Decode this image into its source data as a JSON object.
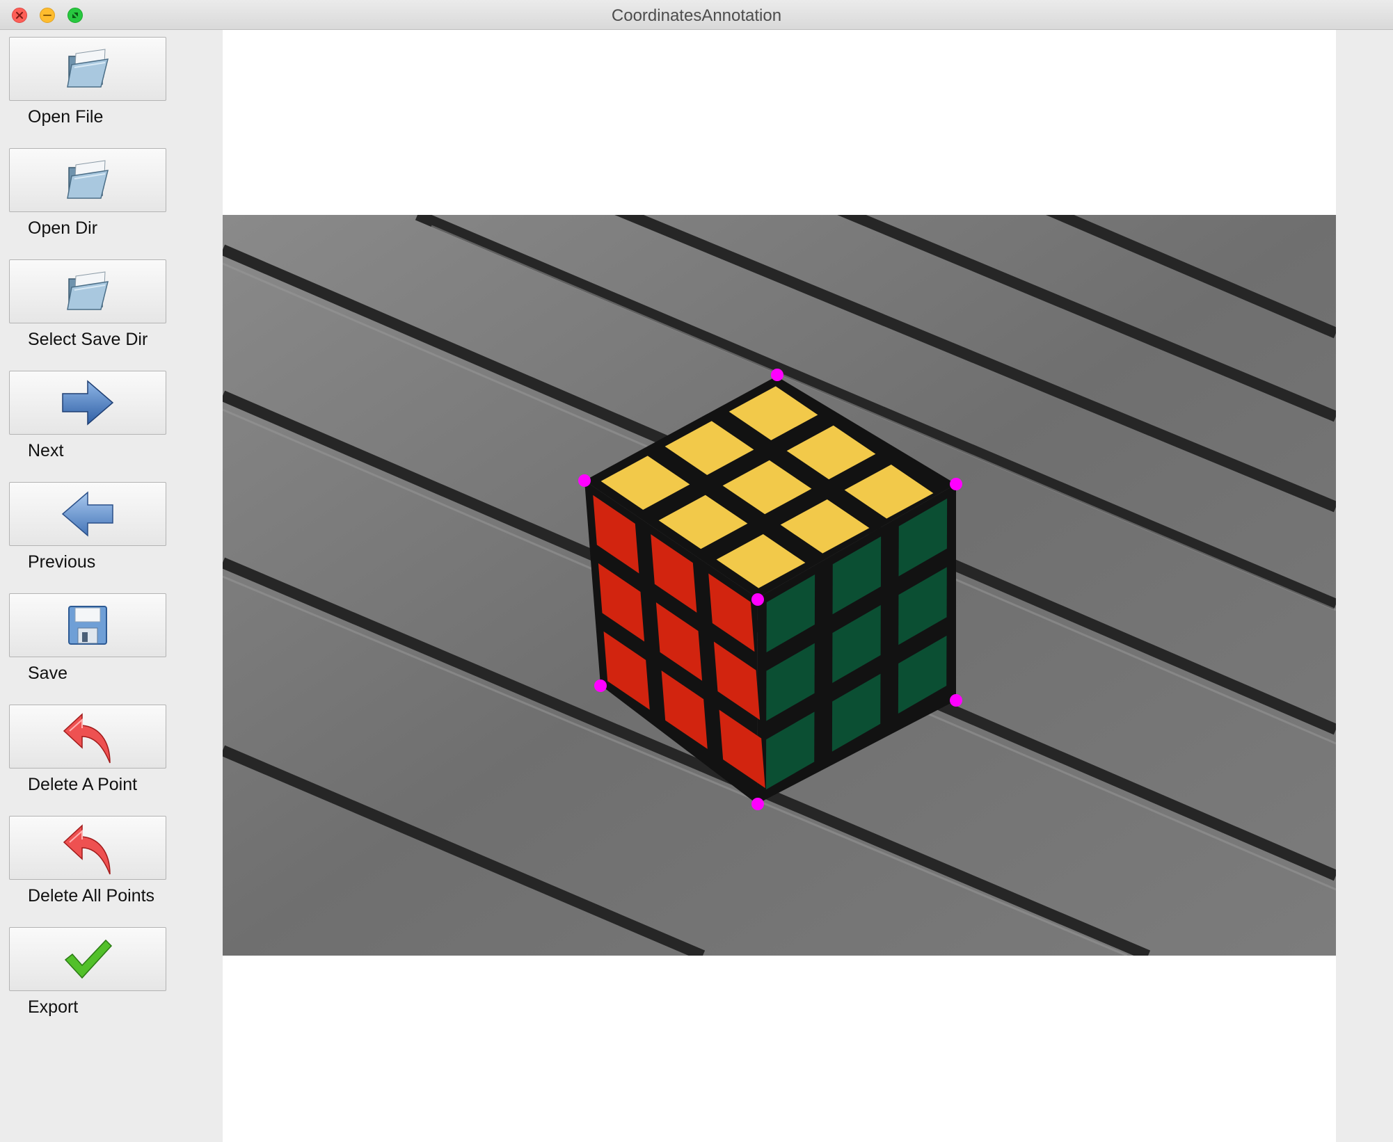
{
  "window": {
    "title": "CoordinatesAnnotation"
  },
  "toolbar": {
    "items": [
      {
        "label": "Open File",
        "icon": "folder-icon"
      },
      {
        "label": "Open Dir",
        "icon": "folder-icon"
      },
      {
        "label": "Select Save Dir",
        "icon": "folder-icon"
      },
      {
        "label": "Next",
        "icon": "arrow-right-icon"
      },
      {
        "label": "Previous",
        "icon": "arrow-left-icon"
      },
      {
        "label": "Save",
        "icon": "floppy-disk-icon"
      },
      {
        "label": "Delete A Point",
        "icon": "undo-arrow-icon"
      },
      {
        "label": "Delete All Points",
        "icon": "undo-arrow-icon"
      },
      {
        "label": "Export",
        "icon": "checkmark-icon"
      }
    ]
  },
  "annotation": {
    "point_color": "#ff00ff",
    "point_count": 7
  },
  "colors": {
    "cube_top": "#f2c94a",
    "cube_left": "#d2240f",
    "cube_right": "#0b4f33",
    "deck": "#7a7a7a"
  }
}
